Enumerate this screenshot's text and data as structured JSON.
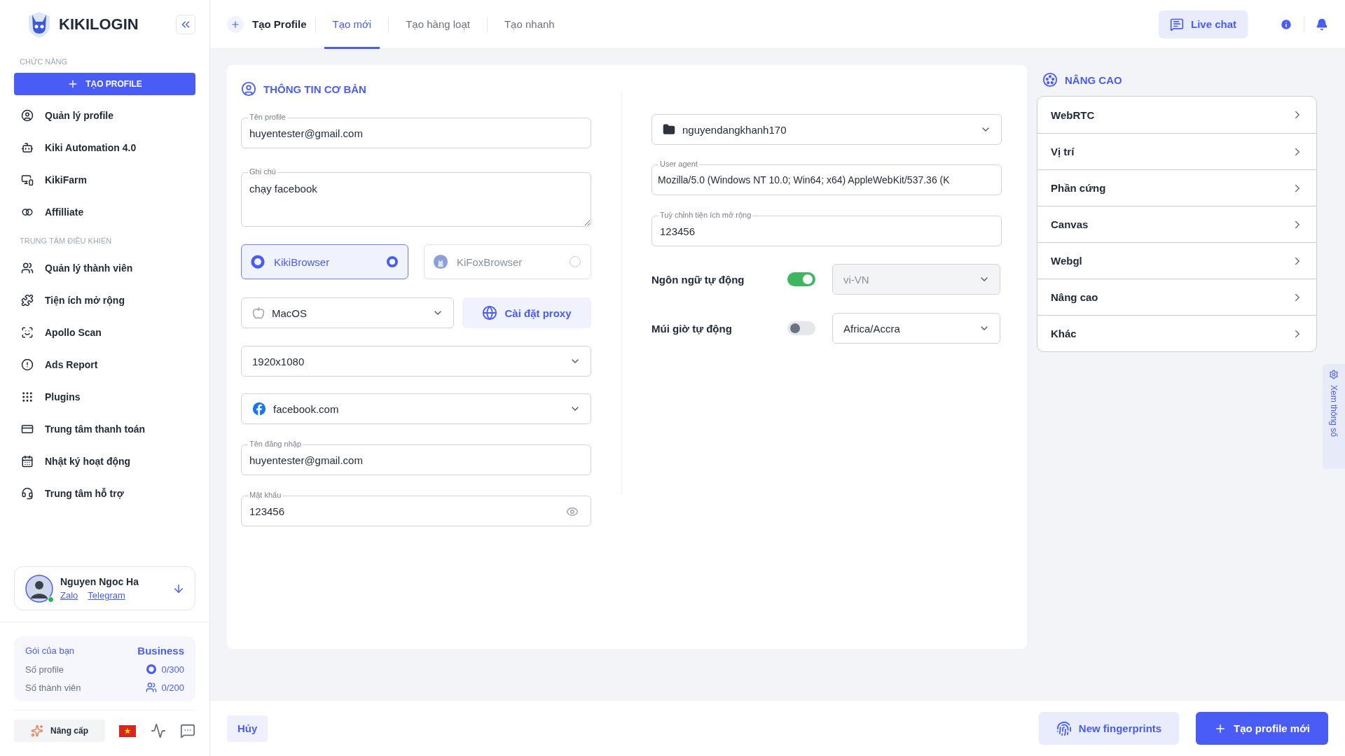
{
  "sidebar": {
    "brand": "KIKILOGIN",
    "sections": [
      {
        "heading": "CHỨC NĂNG",
        "button": "TẠO PROFILE",
        "items": [
          "Quản lý profile",
          "Kiki Automation 4.0",
          "KikiFarm",
          "Affilliate"
        ]
      },
      {
        "heading": "TRUNG TÂM ĐIỀU KHIỂN",
        "items": [
          "Quản lý thành viên",
          "Tiện ích mở rộng",
          "Apollo Scan",
          "Ads Report",
          "Plugins",
          "Trung tâm thanh toán",
          "Nhật ký hoạt động",
          "Trung tâm hỗ trợ"
        ]
      }
    ],
    "user": {
      "name": "Nguyen Ngoc Ha",
      "links": [
        "Zalo",
        "Telegram"
      ],
      "online": true
    },
    "plan": [
      {
        "kind": "title",
        "label": "Gói của bạn",
        "value": "Business"
      },
      {
        "kind": "profile",
        "label": "Số profile",
        "value": "0/300"
      },
      {
        "kind": "members",
        "label": "Số thành viên",
        "value": "0/200"
      }
    ],
    "upgrade": "Nâng cấp"
  },
  "header": {
    "title": "Tạo Profile",
    "tabs": [
      {
        "label": "Tạo mới",
        "selected": true
      },
      {
        "label": "Tạo hàng loạt",
        "selected": false
      },
      {
        "label": "Tạo nhanh",
        "selected": false
      }
    ],
    "live_chat": "Live chat"
  },
  "basic": {
    "title": "THÔNG TIN CƠ BẢN",
    "profile_name": {
      "label": "Tên profile",
      "value": "huyentester@gmail.com"
    },
    "note": {
      "label": "Ghi chú",
      "value": "chạy facebook"
    },
    "browsers": [
      {
        "name": "KikiBrowser",
        "selected": true
      },
      {
        "name": "KiFoxBrowser",
        "selected": false
      }
    ],
    "os": "MacOS",
    "proxy_button": "Cài đặt proxy",
    "resolution": "1920x1080",
    "site": "facebook.com",
    "username": {
      "label": "Tên đăng nhập",
      "value": "huyentester@gmail.com"
    },
    "password": {
      "label": "Mật khẩu",
      "value": "123456"
    }
  },
  "settings": {
    "folder": "nguyendangkhanh170",
    "user_agent": {
      "label": "User agent",
      "value": "Mozilla/5.0 (Windows NT 10.0; Win64; x64) AppleWebKit/537.36 (K"
    },
    "extension": {
      "label": "Tuỳ chỉnh tiện ích mở rộng",
      "value": "123456"
    },
    "toggles": [
      {
        "label": "Ngôn ngữ tự động",
        "on": true,
        "value": "vi-VN"
      },
      {
        "label": "Múi giờ tự động",
        "on": false,
        "value": "Africa/Accra"
      }
    ]
  },
  "advanced": {
    "title": "NÂNG CAO",
    "items": [
      "WebRTC",
      "Vị trí",
      "Phần cứng",
      "Canvas",
      "Webgl",
      "Nâng cao",
      "Khác"
    ]
  },
  "side_tab": "Xem thông số",
  "footer": {
    "cancel": "Hủy",
    "fingerprint": "New fingerprints",
    "create": "Tạo profile mới"
  }
}
